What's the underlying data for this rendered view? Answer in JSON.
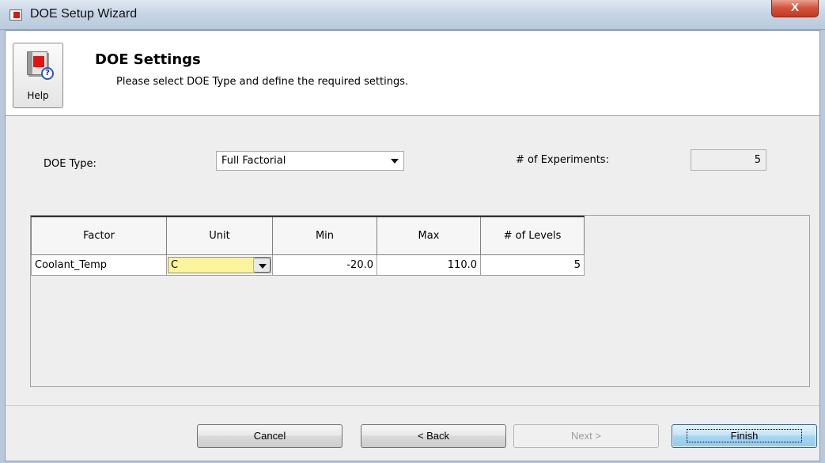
{
  "window": {
    "title": "DOE Setup Wizard",
    "close_glyph": "X"
  },
  "header": {
    "help_label": "Help",
    "help_icon_glyph": "?",
    "title": "DOE Settings",
    "subtitle": "Please select DOE Type and define the required settings."
  },
  "settings": {
    "doe_type_label": "DOE Type:",
    "doe_type_value": "Full Factorial",
    "experiments_label": "# of Experiments:",
    "experiments_value": "5"
  },
  "table": {
    "columns": [
      "Factor",
      "Unit",
      "Min",
      "Max",
      "# of Levels"
    ],
    "rows": [
      {
        "factor": "Coolant_Temp",
        "unit": "C",
        "min": "-20.0",
        "max": "110.0",
        "levels": "5"
      }
    ]
  },
  "buttons": {
    "cancel": "Cancel",
    "back": "< Back",
    "next": "Next >",
    "finish": "Finish"
  },
  "colors": {
    "unit_highlight": "#fbf49c",
    "finish_accent": "#a8d6f3",
    "close_red": "#d4523c"
  }
}
